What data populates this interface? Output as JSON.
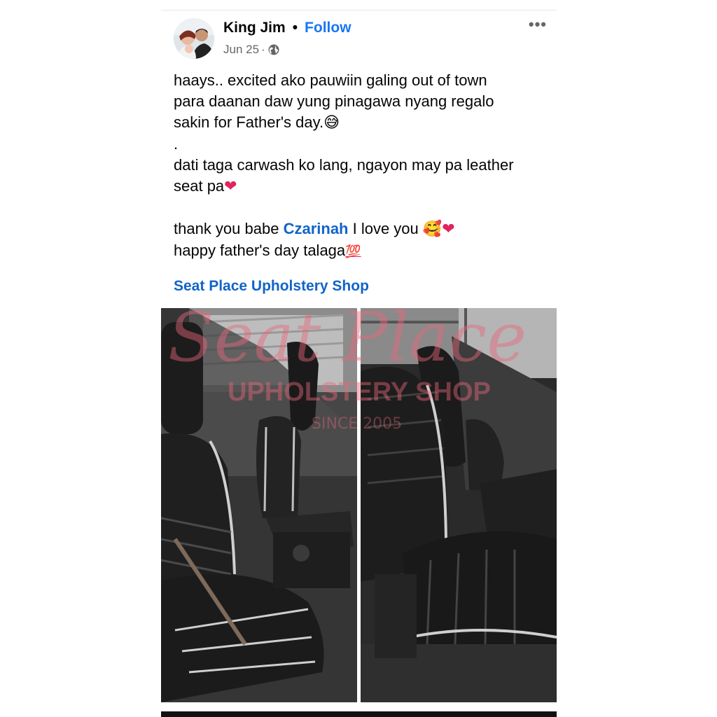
{
  "post": {
    "author": "King Jim",
    "separator": "•",
    "follow_label": "Follow",
    "date": "Jun 25",
    "date_sep": "·",
    "privacy_icon": "globe-icon",
    "more_icon": "more-horizontal-icon",
    "more_label": "•••",
    "lines": {
      "l1": "haays.. excited ako pauwiin galing out of town",
      "l2": "para daanan daw yung pinagawa nyang regalo",
      "l3": "sakin for Father's day.",
      "l3_emoji": "😅",
      "l4": ".",
      "l5": "dati taga carwash ko lang, ngayon may pa leather",
      "l6": "seat pa",
      "l6_emoji": "❤",
      "l7_pre": "thank you babe ",
      "l7_mention": "Czarinah",
      "l7_post": " I love you ",
      "l7_emoji1": "🥰",
      "l7_emoji2": "❤",
      "l8": "happy father's day talaga",
      "l8_emoji": "💯"
    },
    "tagged_page": "Seat Place Upholstery Shop"
  },
  "watermark": {
    "script_text": "Seat Place",
    "shop_text": "UPHOLSTERY SHOP",
    "since_text": "SINCE 2005"
  },
  "colors": {
    "link": "#1264c8",
    "follow": "#1877f2",
    "watermark": "#e8667a"
  }
}
